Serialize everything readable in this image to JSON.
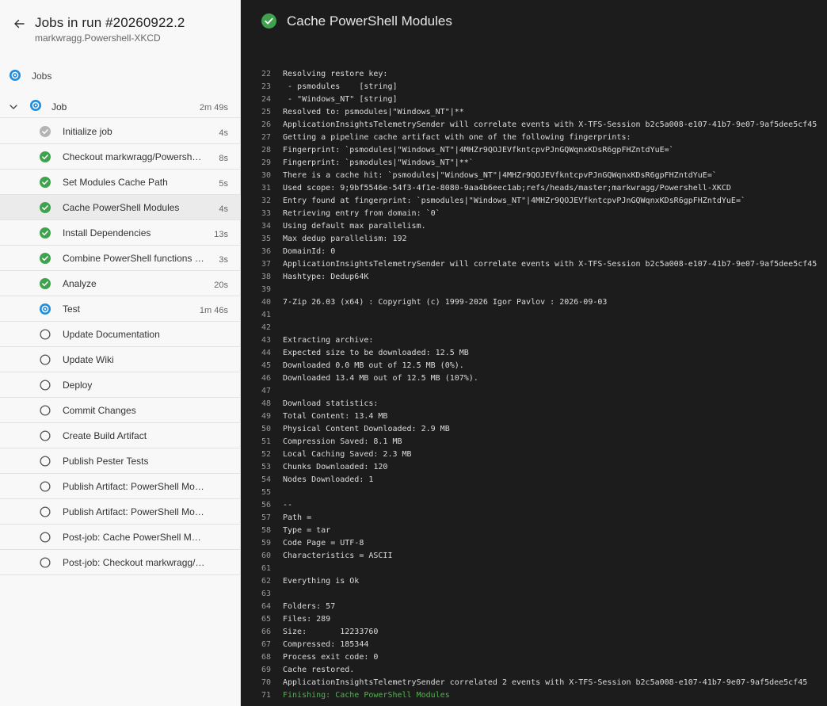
{
  "header": {
    "title": "Jobs in run #20260922.2",
    "subtitle": "markwragg.Powershell-XKCD"
  },
  "jobs_section": {
    "label": "Jobs"
  },
  "job": {
    "label": "Job",
    "duration": "2m 49s"
  },
  "steps": [
    {
      "label": "Initialize job",
      "duration": "4s",
      "status": "done-grey"
    },
    {
      "label": "Checkout markwragg/Powershell-...",
      "duration": "8s",
      "status": "success"
    },
    {
      "label": "Set Modules Cache Path",
      "duration": "5s",
      "status": "success"
    },
    {
      "label": "Cache PowerShell Modules",
      "duration": "4s",
      "status": "success"
    },
    {
      "label": "Install Dependencies",
      "duration": "13s",
      "status": "success"
    },
    {
      "label": "Combine PowerShell functions int...",
      "duration": "3s",
      "status": "success"
    },
    {
      "label": "Analyze",
      "duration": "20s",
      "status": "success"
    },
    {
      "label": "Test",
      "duration": "1m 46s",
      "status": "running"
    },
    {
      "label": "Update Documentation",
      "duration": "",
      "status": "pending"
    },
    {
      "label": "Update Wiki",
      "duration": "",
      "status": "pending"
    },
    {
      "label": "Deploy",
      "duration": "",
      "status": "pending"
    },
    {
      "label": "Commit Changes",
      "duration": "",
      "status": "pending"
    },
    {
      "label": "Create Build Artifact",
      "duration": "",
      "status": "pending"
    },
    {
      "label": "Publish Pester Tests",
      "duration": "",
      "status": "pending"
    },
    {
      "label": "Publish Artifact: PowerShell Module ...",
      "duration": "",
      "status": "pending"
    },
    {
      "label": "Publish Artifact: PowerShell Module",
      "duration": "",
      "status": "pending"
    },
    {
      "label": "Post-job: Cache PowerShell Modules",
      "duration": "",
      "status": "pending"
    },
    {
      "label": "Post-job: Checkout markwragg/Pow...",
      "duration": "",
      "status": "pending"
    }
  ],
  "selected_step": "Cache PowerShell Modules",
  "log": {
    "title": "Cache PowerShell Modules",
    "lines": [
      {
        "n": "22",
        "t": "Resolving restore key:"
      },
      {
        "n": "23",
        "t": " - psmodules    [string]"
      },
      {
        "n": "24",
        "t": " - \"Windows_NT\" [string]"
      },
      {
        "n": "25",
        "t": "Resolved to: psmodules|\"Windows_NT\"|**"
      },
      {
        "n": "26",
        "t": "ApplicationInsightsTelemetrySender will correlate events with X-TFS-Session b2c5a008-e107-41b7-9e07-9af5dee5cf45"
      },
      {
        "n": "27",
        "t": "Getting a pipeline cache artifact with one of the following fingerprints:"
      },
      {
        "n": "28",
        "t": "Fingerprint: `psmodules|\"Windows_NT\"|4MHZr9QOJEVfkntcpvPJnGQWqnxKDsR6gpFHZntdYuE=`"
      },
      {
        "n": "29",
        "t": "Fingerprint: `psmodules|\"Windows_NT\"|**`"
      },
      {
        "n": "30",
        "t": "There is a cache hit: `psmodules|\"Windows_NT\"|4MHZr9QOJEVfkntcpvPJnGQWqnxKDsR6gpFHZntdYuE=`"
      },
      {
        "n": "31",
        "t": "Used scope: 9;9bf5546e-54f3-4f1e-8080-9aa4b6eec1ab;refs/heads/master;markwragg/Powershell-XKCD"
      },
      {
        "n": "32",
        "t": "Entry found at fingerprint: `psmodules|\"Windows_NT\"|4MHZr9QOJEVfkntcpvPJnGQWqnxKDsR6gpFHZntdYuE=`"
      },
      {
        "n": "33",
        "t": "Retrieving entry from domain: `0`"
      },
      {
        "n": "34",
        "t": "Using default max parallelism."
      },
      {
        "n": "35",
        "t": "Max dedup parallelism: 192"
      },
      {
        "n": "36",
        "t": "DomainId: 0"
      },
      {
        "n": "37",
        "t": "ApplicationInsightsTelemetrySender will correlate events with X-TFS-Session b2c5a008-e107-41b7-9e07-9af5dee5cf45"
      },
      {
        "n": "38",
        "t": "Hashtype: Dedup64K"
      },
      {
        "n": "39",
        "t": ""
      },
      {
        "n": "40",
        "t": "7-Zip 26.03 (x64) : Copyright (c) 1999-2026 Igor Pavlov : 2026-09-03"
      },
      {
        "n": "41",
        "t": ""
      },
      {
        "n": "42",
        "t": ""
      },
      {
        "n": "43",
        "t": "Extracting archive:"
      },
      {
        "n": "44",
        "t": "Expected size to be downloaded: 12.5 MB"
      },
      {
        "n": "45",
        "t": "Downloaded 0.0 MB out of 12.5 MB (0%)."
      },
      {
        "n": "46",
        "t": "Downloaded 13.4 MB out of 12.5 MB (107%)."
      },
      {
        "n": "47",
        "t": ""
      },
      {
        "n": "48",
        "t": "Download statistics:"
      },
      {
        "n": "49",
        "t": "Total Content: 13.4 MB"
      },
      {
        "n": "50",
        "t": "Physical Content Downloaded: 2.9 MB"
      },
      {
        "n": "51",
        "t": "Compression Saved: 8.1 MB"
      },
      {
        "n": "52",
        "t": "Local Caching Saved: 2.3 MB"
      },
      {
        "n": "53",
        "t": "Chunks Downloaded: 120"
      },
      {
        "n": "54",
        "t": "Nodes Downloaded: 1"
      },
      {
        "n": "55",
        "t": ""
      },
      {
        "n": "56",
        "t": "--"
      },
      {
        "n": "57",
        "t": "Path ="
      },
      {
        "n": "58",
        "t": "Type = tar"
      },
      {
        "n": "59",
        "t": "Code Page = UTF-8"
      },
      {
        "n": "60",
        "t": "Characteristics = ASCII"
      },
      {
        "n": "61",
        "t": ""
      },
      {
        "n": "62",
        "t": "Everything is Ok"
      },
      {
        "n": "63",
        "t": ""
      },
      {
        "n": "64",
        "t": "Folders: 57"
      },
      {
        "n": "65",
        "t": "Files: 289"
      },
      {
        "n": "66",
        "t": "Size:       12233760"
      },
      {
        "n": "67",
        "t": "Compressed: 185344"
      },
      {
        "n": "68",
        "t": "Process exit code: 0"
      },
      {
        "n": "69",
        "t": "Cache restored."
      },
      {
        "n": "70",
        "t": "ApplicationInsightsTelemetrySender correlated 2 events with X-TFS-Session b2c5a008-e107-41b7-9e07-9af5dee5cf45"
      },
      {
        "n": "71",
        "t": "Finishing: Cache PowerShell Modules",
        "green": true
      }
    ]
  },
  "colors": {
    "success": "#3fa34d",
    "running": "#1f8ddb",
    "pending_ring": "#555555",
    "done_grey": "#b4b4b4",
    "finishing_text": "#54b054"
  },
  "icons": {
    "back": "arrow-left-icon",
    "expand": "chevron-down-icon",
    "success": "check-circle-icon",
    "running": "running-spinner-icon",
    "pending": "empty-circle-icon"
  }
}
